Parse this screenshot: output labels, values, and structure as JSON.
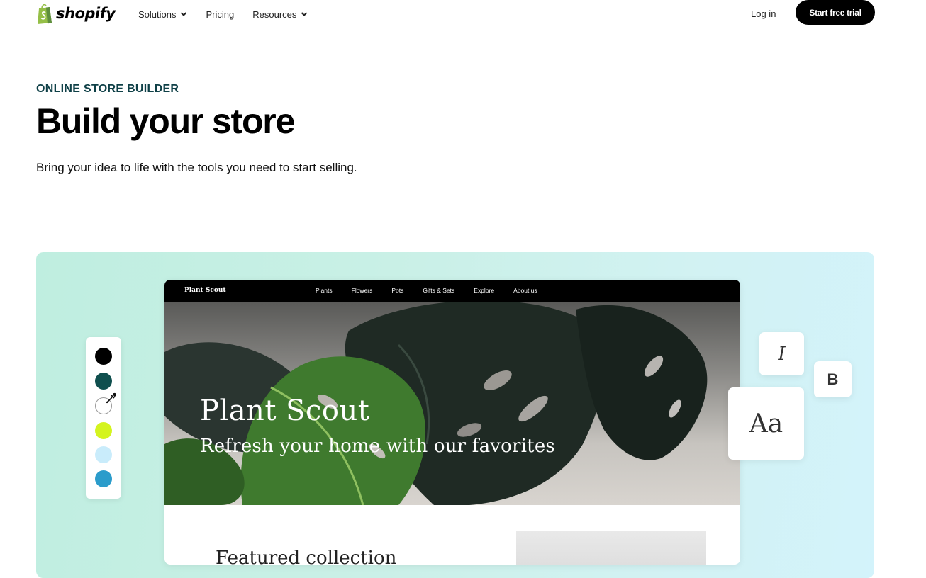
{
  "header": {
    "logo_text": "shopify",
    "nav": [
      {
        "label": "Solutions",
        "has_dropdown": true
      },
      {
        "label": "Pricing",
        "has_dropdown": false
      },
      {
        "label": "Resources",
        "has_dropdown": true
      }
    ],
    "login_label": "Log in",
    "cta_label": "Start free trial"
  },
  "hero": {
    "eyebrow": "ONLINE STORE BUILDER",
    "title": "Build your store",
    "subtitle": "Bring your idea to life with the tools you need to start selling."
  },
  "store_preview": {
    "brand": "Plant Scout",
    "nav_links": [
      "Plants",
      "Flowers",
      "Pots",
      "Gifts & Sets",
      "Explore",
      "About us"
    ],
    "hero_title": "Plant Scout",
    "hero_subtitle": "Refresh your home with our favorites",
    "featured_heading": "Featured collection"
  },
  "palette": {
    "colors": [
      "#000000",
      "#0f4f4e",
      "#ffffff",
      "#d4f41f",
      "#c9ecfb",
      "#2b9ccb"
    ],
    "tool_icon": "eyedropper-icon"
  },
  "typography_cards": {
    "italic_label": "I",
    "bold_label": "B",
    "font_label": "Aa"
  },
  "colors": {
    "brand_green": "#95bf47",
    "eyebrow": "#0f4047",
    "cta_bg": "#000000"
  }
}
